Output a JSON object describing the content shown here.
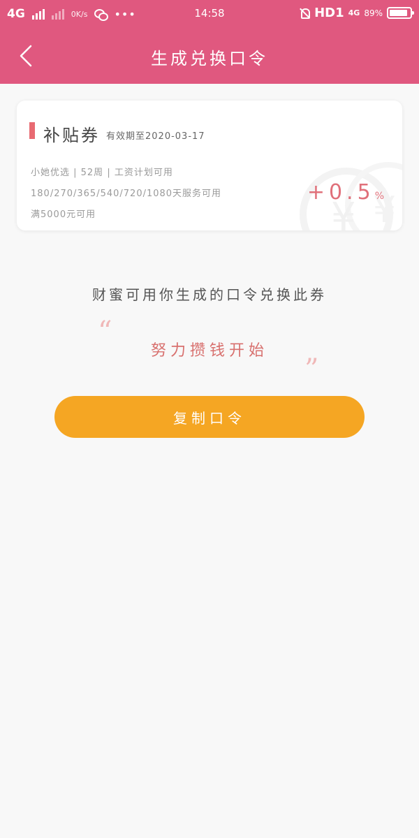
{
  "status_bar": {
    "network": "4G",
    "speed": "0K/s",
    "time": "14:58",
    "hd": "HD1",
    "net2": "4G",
    "battery_percent": "89%",
    "battery_level": 0.89
  },
  "nav": {
    "title": "生成兑换口令",
    "back_icon": "chevron-left-icon"
  },
  "coupon": {
    "title": "补贴券",
    "expiry": "有效期至2020-03-17",
    "line1": "小她优选 | 52周 | 工资计划可用",
    "line2": "180/270/365/540/720/1080天服务可用",
    "line3": "满5000元可用",
    "rate": "+0.5",
    "rate_unit": "%",
    "accent_color": "#e86a72"
  },
  "description": "财蜜可用你生成的口令兑换此券",
  "quote_open": "“",
  "quote_close": "”",
  "code_text": "努力攒钱开始",
  "copy_button": "复制口令",
  "colors": {
    "header": "#e0587f",
    "button": "#f5a623",
    "background": "#f8f8f8"
  }
}
